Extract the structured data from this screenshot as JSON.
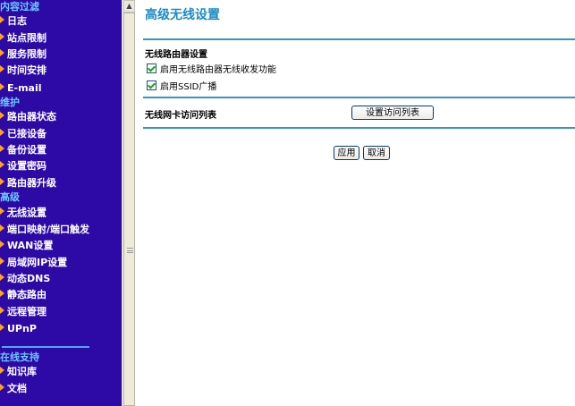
{
  "sidebar": {
    "sections": [
      {
        "title": "内容过滤",
        "items": [
          "日志",
          "站点限制",
          "服务限制",
          "时间安排",
          "E-mail"
        ]
      },
      {
        "title": "维护",
        "items": [
          "路由器状态",
          "已接设备",
          "备份设置",
          "设置密码",
          "路由器升级"
        ]
      },
      {
        "title": "高级",
        "items": [
          "无线设置",
          "端口映射/端口触发",
          "WAN设置",
          "局域网IP设置",
          "动态DNS",
          "静态路由",
          "远程管理",
          "UPnP"
        ]
      },
      {
        "title": "在线支持",
        "items": [
          "知识库",
          "文档"
        ]
      }
    ],
    "active_item": "无线设置"
  },
  "main": {
    "title": "高级无线设置",
    "router_section_label": "无线路由器设置",
    "checkbox_enable_radio": {
      "label": "启用无线路由器无线收发功能",
      "checked": true
    },
    "checkbox_ssid_broadcast": {
      "label": "启用SSID广播",
      "checked": true
    },
    "access_list_label": "无线网卡访问列表",
    "setup_access_list_button": "设置访问列表",
    "apply_button": "应用",
    "cancel_button": "取消"
  },
  "colors": {
    "sidebar_bg": "#2d0aa6",
    "section_title": "#6ec8ff",
    "arrow": "#ffa21c",
    "title": "#1a8bc4",
    "rule": "#3a93c4"
  }
}
